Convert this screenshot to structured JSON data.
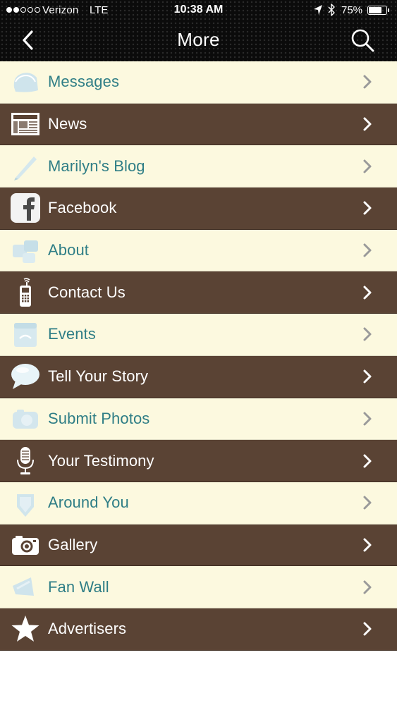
{
  "status_bar": {
    "signal_bars_filled": 2,
    "signal_bars_total": 5,
    "carrier": "Verizon",
    "network": "LTE",
    "time": "10:38 AM",
    "battery_percent_label": "75%",
    "battery_level": 0.75
  },
  "nav": {
    "title": "More",
    "back_icon": "chevron-left-icon",
    "search_icon": "search-icon"
  },
  "colors": {
    "bar_background": "#0b0b0b",
    "row_light": "#fcf9df",
    "row_dark": "#5a4334",
    "label_light": "#2f7e86",
    "label_dark": "#ffffff"
  },
  "menu": {
    "items": [
      {
        "label": "Messages",
        "icon": "messages-icon",
        "theme": "light"
      },
      {
        "label": "News",
        "icon": "newspaper-icon",
        "theme": "dark"
      },
      {
        "label": "Marilyn's Blog",
        "icon": "pen-icon",
        "theme": "light"
      },
      {
        "label": "Facebook",
        "icon": "facebook-icon",
        "theme": "dark"
      },
      {
        "label": "About",
        "icon": "about-icon",
        "theme": "light"
      },
      {
        "label": "Contact Us",
        "icon": "mobile-phone-icon",
        "theme": "dark"
      },
      {
        "label": "Events",
        "icon": "calendar-icon",
        "theme": "light"
      },
      {
        "label": "Tell Your Story",
        "icon": "speech-bubble-icon",
        "theme": "dark"
      },
      {
        "label": "Submit Photos",
        "icon": "photo-upload-icon",
        "theme": "light"
      },
      {
        "label": "Your Testimony",
        "icon": "microphone-icon",
        "theme": "dark"
      },
      {
        "label": "Around You",
        "icon": "map-pin-icon",
        "theme": "light"
      },
      {
        "label": "Gallery",
        "icon": "camera-icon",
        "theme": "dark"
      },
      {
        "label": "Fan Wall",
        "icon": "megaphone-icon",
        "theme": "light"
      },
      {
        "label": "Advertisers",
        "icon": "star-icon",
        "theme": "dark"
      }
    ]
  }
}
